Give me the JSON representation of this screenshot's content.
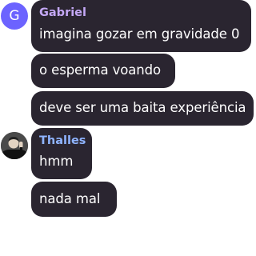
{
  "colors": {
    "bubble_bg": "#2a2530",
    "text": "#ffffff",
    "gabriel_name": "#c4a8f5",
    "thalles_name": "#8fb4ff",
    "gabriel_avatar": "#6c63ff"
  },
  "messages": [
    {
      "author": "Gabriel",
      "avatar": {
        "type": "letter",
        "letter": "G"
      },
      "lines": [
        "imagina gozar em gravidade 0",
        "o esperma voando",
        "deve ser uma baita experiência"
      ]
    },
    {
      "author": "Thalles",
      "avatar": {
        "type": "image",
        "icon": "person-waving-photo"
      },
      "lines": [
        "hmm",
        "nada mal"
      ]
    }
  ]
}
